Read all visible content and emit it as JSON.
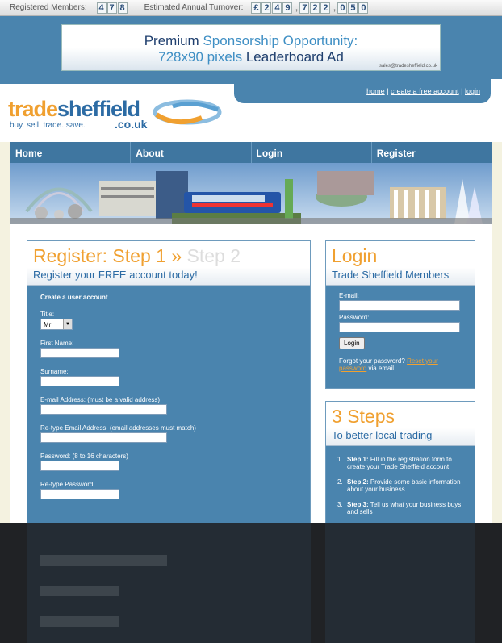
{
  "stats": {
    "members_label": "Registered Members:",
    "members": [
      "4",
      "7",
      "8"
    ],
    "turnover_label": "Estimated Annual Turnover:",
    "turnover": [
      "£",
      "2",
      "4",
      "9",
      ",",
      "7",
      "2",
      "2",
      ",",
      "0",
      "5",
      "0"
    ]
  },
  "ad": {
    "word1": "Premium",
    "word2": "Sponsorship Opportunity:",
    "line2a": "728x90 pixels",
    "line2b": "Leaderboard Ad",
    "email": "sales@tradesheffield.co.uk"
  },
  "toplinks": {
    "home": "home",
    "create": "create a free account",
    "login": "login",
    "sep": "|"
  },
  "logo": {
    "trade": "trade",
    "sheffield": "sheffield",
    "couk": ".co.uk",
    "tagline": "buy. sell. trade. save."
  },
  "nav": [
    "Home",
    "About",
    "Login",
    "Register"
  ],
  "register": {
    "title_active": "Register: Step 1",
    "title_sep": "»",
    "title_next": "Step 2",
    "subtitle": "Register your FREE account today!",
    "section": "Create a user account",
    "title_label": "Title:",
    "title_value": "Mr",
    "first_name": "First Name:",
    "surname": "Surname:",
    "email": "E-mail Address: (must be a valid address)",
    "email2": "Re-type Email Address: (email addresses must match)",
    "password": "Password: (8 to 16 characters)",
    "password2": "Re-type Password:"
  },
  "login": {
    "title": "Login",
    "subtitle": "Trade Sheffield Members",
    "email": "E-mail:",
    "password": "Password:",
    "button": "Login",
    "forgot": "Forgot your password?",
    "reset": "Reset your password",
    "via": "via email"
  },
  "steps": {
    "title": "3 Steps",
    "subtitle": "To better local trading",
    "items": [
      {
        "num": "1.",
        "label": "Step 1:",
        "text": "Fill in the registration form to create your Trade Sheffield account"
      },
      {
        "num": "2.",
        "label": "Step 2:",
        "text": "Provide some basic information about your business"
      },
      {
        "num": "3.",
        "label": "Step 3:",
        "text": "Tell us what your business buys and sells"
      }
    ]
  },
  "colors": {
    "blue": "#4a84ae",
    "orange": "#f0a030",
    "dark_blue": "#2c6ba4"
  }
}
